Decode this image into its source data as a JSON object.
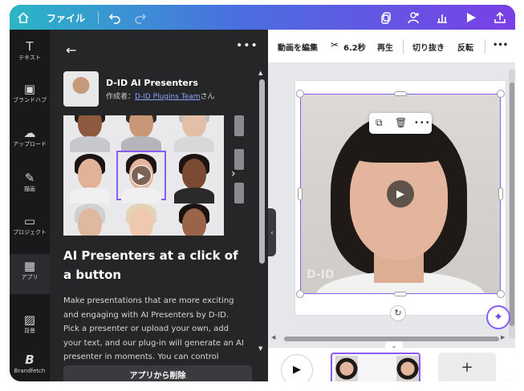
{
  "topbar": {
    "file_label": "ファイル",
    "icons": [
      "home-icon",
      "undo-icon",
      "redo-icon",
      "copy-icon",
      "share-people-icon",
      "analytics-icon",
      "present-icon",
      "upload-icon"
    ]
  },
  "rail": {
    "items": [
      {
        "label": "テキスト",
        "icon": "T"
      },
      {
        "label": "ブランドハブ",
        "icon": "▣"
      },
      {
        "label": "アップロード",
        "icon": "☁"
      },
      {
        "label": "描画",
        "icon": "✎"
      },
      {
        "label": "プロジェクト",
        "icon": "▭"
      },
      {
        "label": "アプリ",
        "icon": "▦"
      },
      {
        "label": "背景",
        "icon": "▨"
      },
      {
        "label": "Brandfetch",
        "icon": "B"
      }
    ]
  },
  "panel": {
    "back_icon": "←",
    "more_icon": "•••",
    "app_name": "D-ID AI Presenters",
    "author_prefix": "作成者：",
    "author_link": "D-ID Plugins Team",
    "author_suffix": "さん",
    "headline": "AI Presenters at a click of a button",
    "description": "Make presentations that are more exciting and engaging with AI Presenters by D-ID. Pick a presenter or upload your own, add your text, and our plug-in will generate an AI presenter in moments. You can control",
    "remove_button": "アプリから削除",
    "next_icon": "›"
  },
  "canvas": {
    "toolbar": {
      "edit_video": "動画を編集",
      "duration": "6.2秒",
      "play": "再生",
      "crop": "切り抜き",
      "flip": "反転",
      "more": "•••"
    },
    "watermark": "D-ID",
    "float_toolbar_icons": [
      "duplicate-icon",
      "trash-icon",
      "more-icon"
    ]
  },
  "timeline": {
    "add_label": "+"
  },
  "colors": {
    "accent": "#8a5cf6",
    "gradient_start": "#2bb6c6",
    "gradient_end": "#7a3fe6",
    "panel_bg": "#252627"
  }
}
